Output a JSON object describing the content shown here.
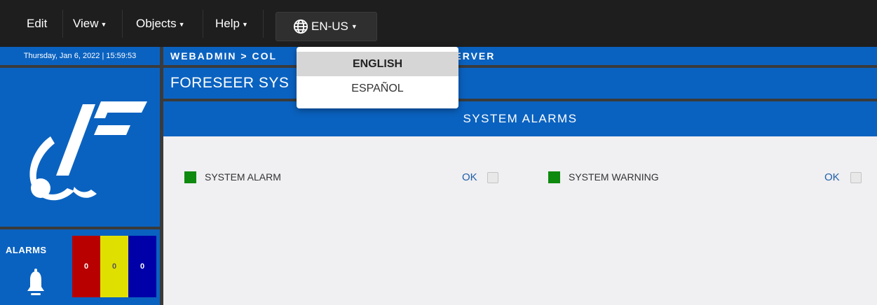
{
  "menubar": {
    "items": [
      {
        "label": "Edit",
        "has_caret": false
      },
      {
        "label": "View",
        "has_caret": true
      },
      {
        "label": "Objects",
        "has_caret": true
      },
      {
        "label": "Help",
        "has_caret": true
      }
    ],
    "language_button": {
      "label": "EN-US",
      "icon": "globe-icon"
    }
  },
  "datetime": "Thursday, Jan 6, 2022 | 15:59:53",
  "breadcrumb": "WEBADMIN > COL",
  "breadcrumb_tail": "R SERVER",
  "page_title": "FORESEER SYS",
  "alarms": {
    "label": "ALARMS",
    "icon": "bell-icon",
    "counts": {
      "critical": "0",
      "warning": "0",
      "info": "0"
    },
    "colors": {
      "critical": "#b80000",
      "warning": "#e0e000",
      "info": "#0000a8"
    }
  },
  "section": {
    "title": "SYSTEM ALARMS"
  },
  "system_alarm": {
    "label": "SYSTEM ALARM",
    "status": "OK",
    "color": "#0e8a0e"
  },
  "system_warning": {
    "label": "SYSTEM WARNING",
    "status": "OK",
    "color": "#0e8a0e"
  },
  "language_dropdown": {
    "options": [
      {
        "label": "ENGLISH",
        "selected": true
      },
      {
        "label": "ESPAÑOL",
        "selected": false
      }
    ]
  },
  "colors": {
    "brand_blue": "#0a62c0",
    "menubar": "#1e1e1e"
  }
}
